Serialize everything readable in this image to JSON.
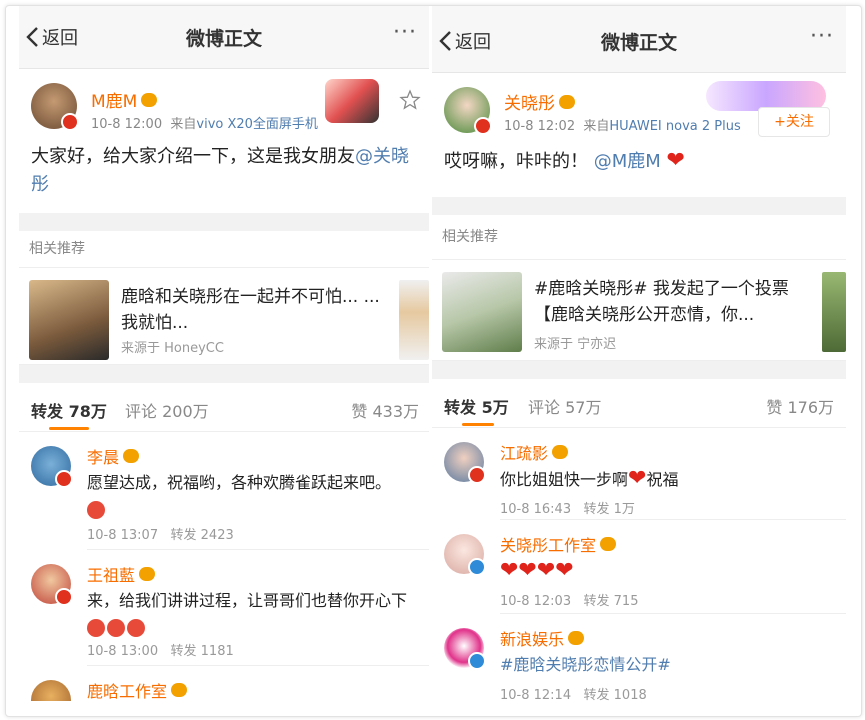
{
  "left": {
    "nav": {
      "back": "返回",
      "title": "微博正文",
      "more": "···"
    },
    "post": {
      "username": "M鹿M",
      "time": "10-8 12:00",
      "source_prefix": "来自",
      "device": "vivo X20全面屏手机",
      "text": "大家好，给大家介绍一下，这是我女朋友",
      "mention": "@关晓彤"
    },
    "related_title": "相关推荐",
    "related": {
      "title": "鹿晗和关晓彤在一起并不可怕... ... 我就怕...",
      "source": "来源于 HoneyCC"
    },
    "tabs": {
      "repost_label": "转发",
      "repost_count": "78万",
      "comment_label": "评论",
      "comment_count": "200万",
      "like_label": "赞",
      "like_count": "433万"
    },
    "comments": [
      {
        "name": "李晨",
        "text": "愿望达成，祝福哟，各种欢腾雀跃起来吧。",
        "time": "10-8 13:07",
        "repost": "转发 2423"
      },
      {
        "name": "王祖藍",
        "text": "来，给我们讲讲过程，让哥哥们也替你开心下",
        "time": "10-8 13:00",
        "repost": "转发 1181"
      },
      {
        "name": "鹿晗工作室"
      }
    ]
  },
  "right": {
    "nav": {
      "back": "返回",
      "title": "微博正文",
      "more": "···"
    },
    "post": {
      "username": "关晓彤",
      "time": "10-8 12:02",
      "source_prefix": "来自",
      "device": "HUAWEI nova 2 Plus",
      "follow": "+关注",
      "text": "哎呀嘛，咔咔的！",
      "mention": "@M鹿M",
      "heart": "❤"
    },
    "related_title": "相关推荐",
    "related": {
      "title": "#鹿晗关晓彤# 我发起了一个投票 【鹿晗关晓彤公开恋情，你...",
      "source": "来源于 宁亦迟"
    },
    "tabs": {
      "repost_label": "转发",
      "repost_count": "5万",
      "comment_label": "评论",
      "comment_count": "57万",
      "like_label": "赞",
      "like_count": "176万"
    },
    "comments": [
      {
        "name": "江疏影",
        "text": "你比姐姐快一步啊",
        "text2": "祝福",
        "time": "10-8 16:43",
        "repost": "转发 1万"
      },
      {
        "name": "关晓彤工作室",
        "hearts": "❤❤❤❤",
        "time": "10-8 12:03",
        "repost": "转发 715"
      },
      {
        "name": "新浪娱乐",
        "text": "#鹿晗关晓彤恋情公开#",
        "time": "10-8 12:14",
        "repost": "转发 1018"
      }
    ]
  }
}
